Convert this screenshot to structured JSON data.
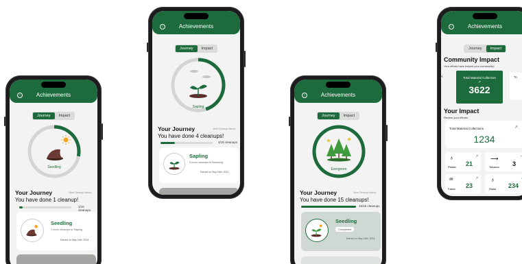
{
  "app": {
    "title": "Achievements",
    "tab_journey": "Journey",
    "tab_impact": "Impact"
  },
  "colors": {
    "brand_green": "#1d6b3c",
    "track_gray": "#d8dad8"
  },
  "phone1": {
    "level_name": "Seedling",
    "progress_fraction": 0.28,
    "section_title": "Your Journey",
    "history_link": "View Cleanup History",
    "done_text": "You have done 1 cleanup!",
    "count": "1/15 cleanups",
    "bar_fraction": 0.07,
    "card": {
      "name": "Seedling",
      "sub": "1 more cleanups to Sapling",
      "earned": "Earned on May 16th, 2024"
    }
  },
  "phone2": {
    "level_name": "Sapling",
    "progress_fraction": 0.45,
    "section_title": "Your Journey",
    "history_link": "View Cleanup History",
    "done_text": "You have done 4 cleanups!",
    "count": "4/15 cleanups",
    "bar_fraction": 0.27,
    "card": {
      "name": "Sapling",
      "sub": "3 more cleanups to Blooming",
      "earned": "Earned on May 16th, 2024"
    }
  },
  "phone3": {
    "level_name": "Evergreen",
    "progress_fraction": 1.0,
    "section_title": "Your Journey",
    "history_link": "View Cleanup History",
    "done_text": "You have done 15 cleanups!",
    "count": "15/15 cleanups",
    "bar_fraction": 1.0,
    "card": {
      "name": "Seedling",
      "badge": "Completed",
      "earned": "Earned on May 16th, 2024"
    }
  },
  "phone4": {
    "community_title": "Community Impact",
    "community_sub": "Your efforts have helped your community!",
    "collection_label": "Total Material Collection",
    "collection_value": "3622",
    "side_label": "To",
    "impact_title": "Your Impact",
    "impact_sub": "Review your efforts!",
    "collections_label": "Total Material Collections",
    "collections_value": "1234",
    "materials": [
      {
        "name": "Plastic",
        "value": "21"
      },
      {
        "name": "Tobacco",
        "value": "3"
      },
      {
        "name": "Fabric",
        "value": "23"
      },
      {
        "name": "Glass",
        "value": "234"
      }
    ]
  }
}
